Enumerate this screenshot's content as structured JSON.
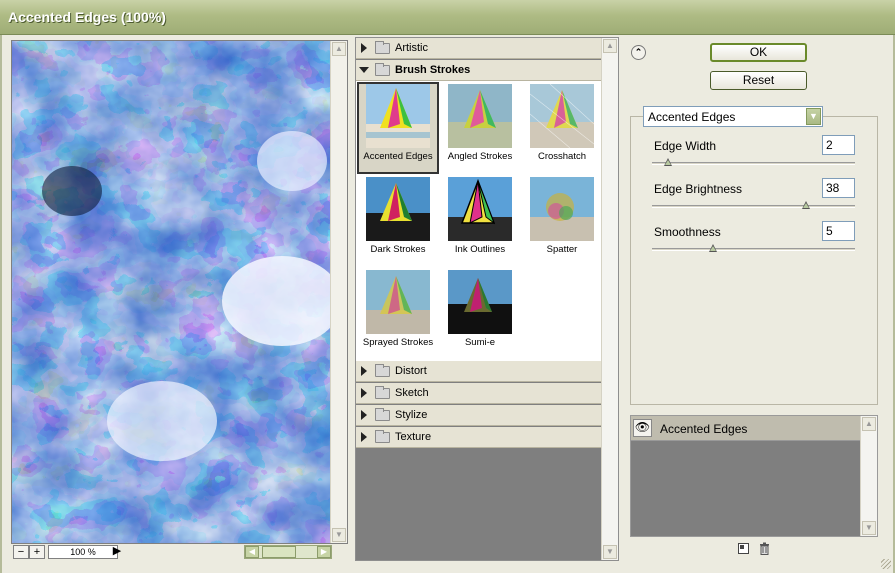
{
  "window": {
    "title": "Accented Edges (100%)"
  },
  "preview": {
    "zoom_value": "100 %",
    "zoom_out": "−",
    "zoom_in": "+"
  },
  "gallery": {
    "categories_top": [
      {
        "label": "Artistic",
        "expanded": false
      },
      {
        "label": "Brush Strokes",
        "expanded": true
      }
    ],
    "thumbnails": [
      {
        "label": "Accented Edges",
        "selected": true
      },
      {
        "label": "Angled Strokes",
        "selected": false
      },
      {
        "label": "Crosshatch",
        "selected": false
      },
      {
        "label": "Dark Strokes",
        "selected": false
      },
      {
        "label": "Ink Outlines",
        "selected": false
      },
      {
        "label": "Spatter",
        "selected": false
      },
      {
        "label": "Sprayed Strokes",
        "selected": false
      },
      {
        "label": "Sumi-e",
        "selected": false
      }
    ],
    "categories_bottom": [
      {
        "label": "Distort"
      },
      {
        "label": "Sketch"
      },
      {
        "label": "Stylize"
      },
      {
        "label": "Texture"
      }
    ]
  },
  "buttons": {
    "ok": "OK",
    "reset": "Reset"
  },
  "settings": {
    "filter_select": "Accented Edges",
    "params": [
      {
        "label": "Edge Width",
        "value": "2",
        "fraction": 0.08
      },
      {
        "label": "Edge Brightness",
        "value": "38",
        "fraction": 0.76
      },
      {
        "label": "Smoothness",
        "value": "5",
        "fraction": 0.3
      }
    ]
  },
  "layers": {
    "items": [
      {
        "label": "Accented Edges",
        "visible": true
      }
    ]
  },
  "colors": {
    "accent": "#9fad76",
    "preview_blue": "#2e63c8"
  }
}
